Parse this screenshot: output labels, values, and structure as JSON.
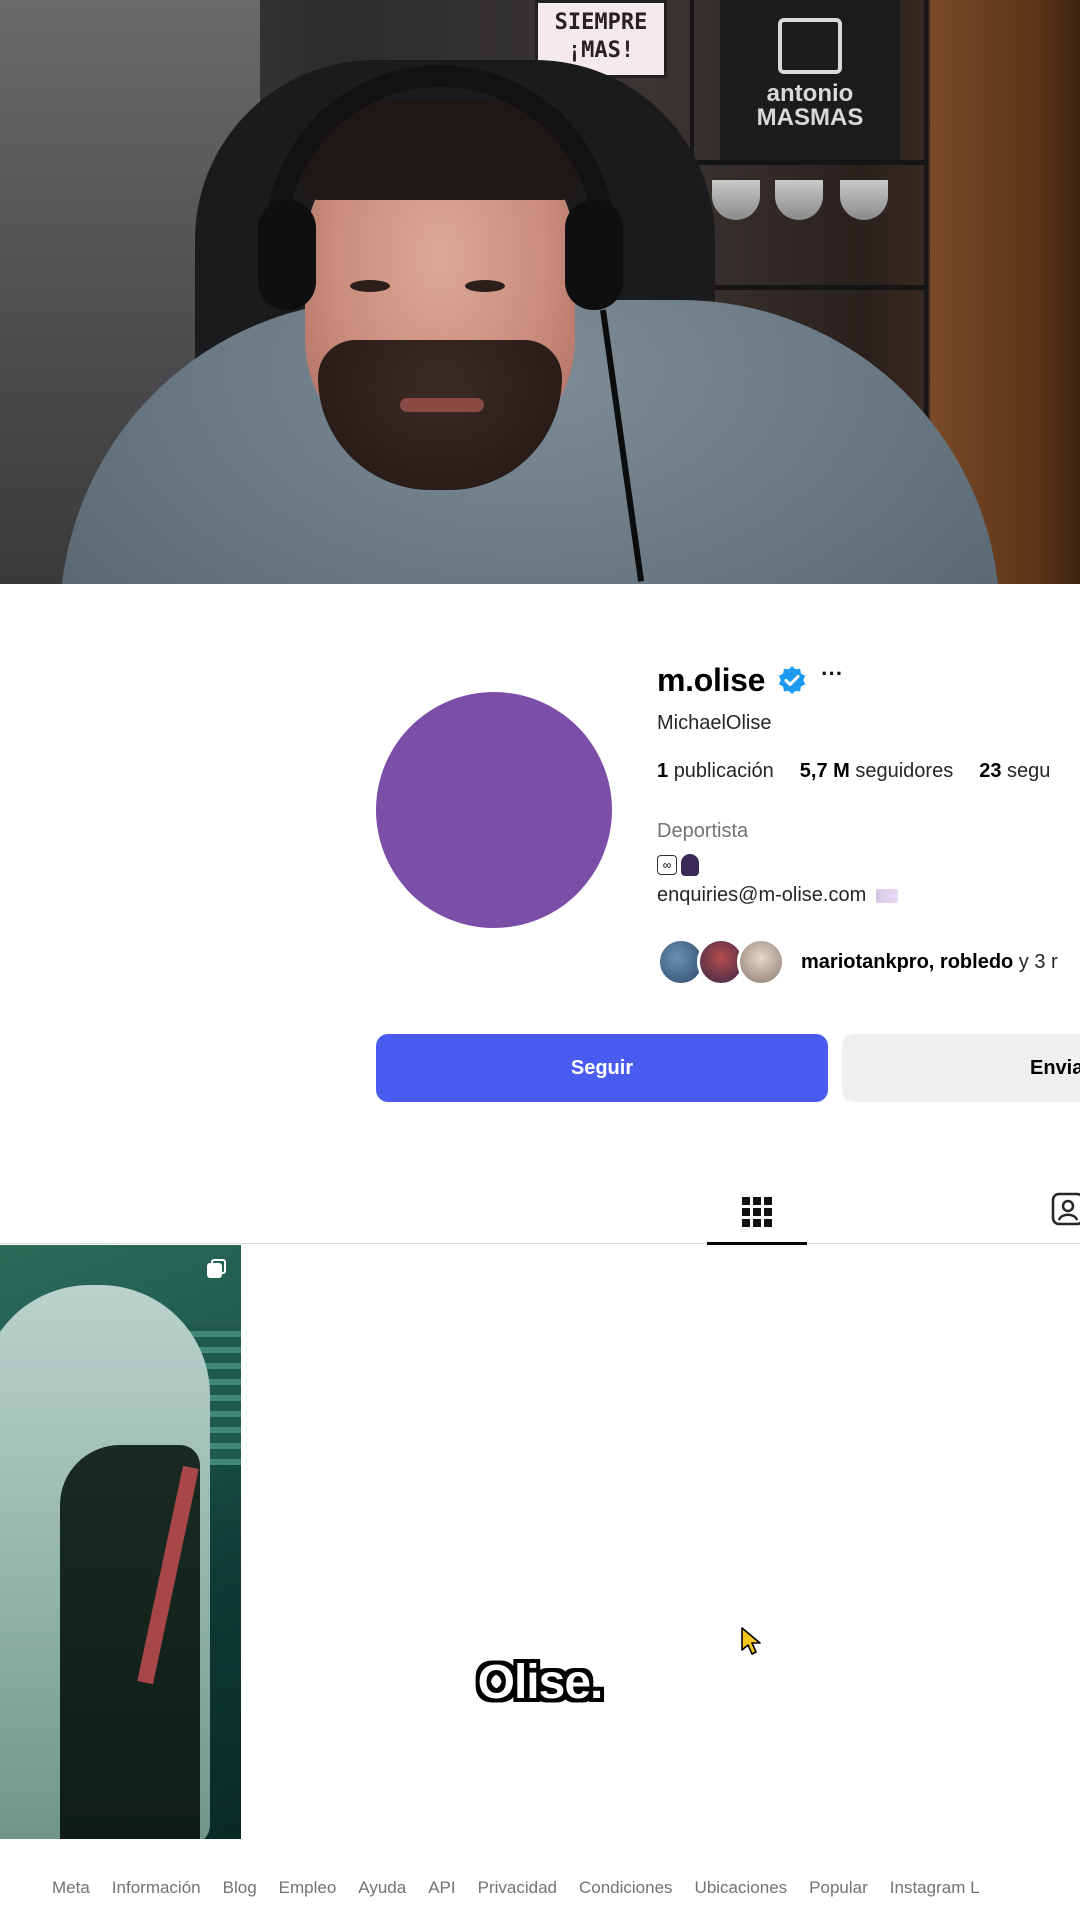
{
  "webcam": {
    "sign_lines": [
      "SIEMPRE",
      "¡MAS!"
    ],
    "poster_lines": [
      "antonio",
      "MASMAS"
    ]
  },
  "profile": {
    "username": "m.olise",
    "more": "···",
    "full_name": "MichaelOlise",
    "stats": [
      {
        "count": "1",
        "label": "publicación"
      },
      {
        "count": "5,7 M",
        "label": "seguidores"
      },
      {
        "count": "23",
        "label": "segu"
      }
    ],
    "category": "Deportista",
    "email": "enquiries@m-olise.com",
    "followed_by": {
      "names": "mariotankpro, robledo",
      "suffix": " y 3 r"
    },
    "avatar_color": "#7b4ea8"
  },
  "actions": {
    "follow_label": "Seguir",
    "message_label": "Envia",
    "follow_color": "#4a5cf0"
  },
  "subtitle": "Olise.",
  "footer": {
    "links": [
      "Meta",
      "Información",
      "Blog",
      "Empleo",
      "Ayuda",
      "API",
      "Privacidad",
      "Condiciones",
      "Ubicaciones",
      "Popular",
      "Instagram L"
    ]
  }
}
